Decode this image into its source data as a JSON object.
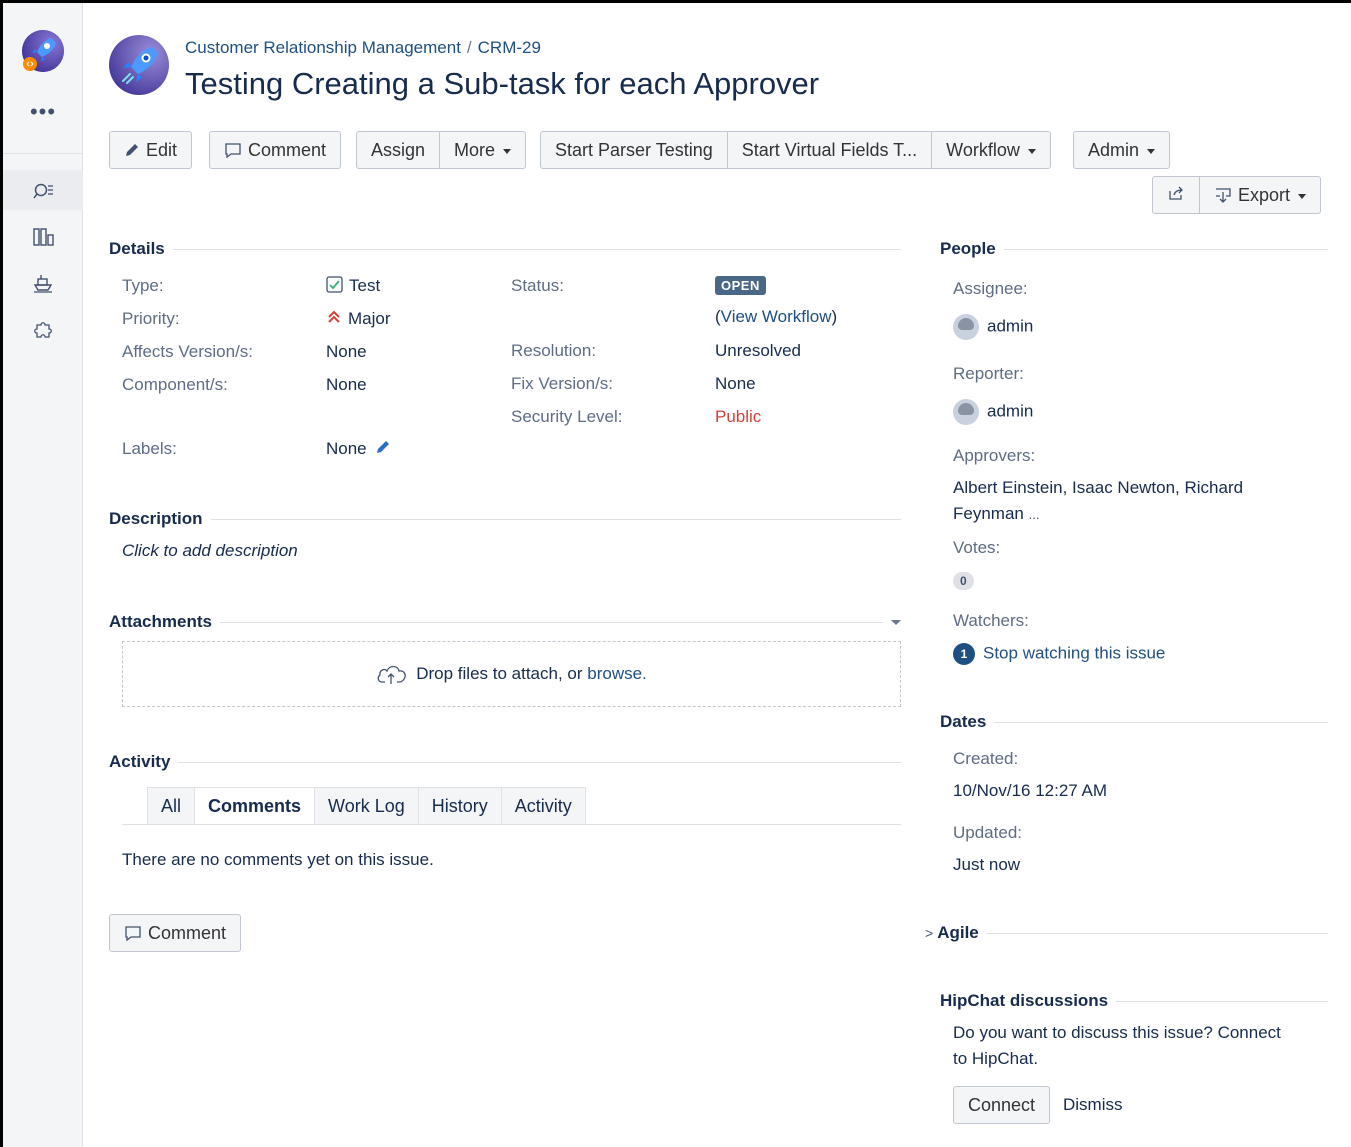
{
  "project": {
    "name": "Customer Relationship Management",
    "issue_key": "CRM-29"
  },
  "issue": {
    "title": "Testing Creating a Sub-task for each Approver"
  },
  "sidebar": {
    "more": "•••"
  },
  "toolbar": {
    "edit": "Edit",
    "comment": "Comment",
    "assign": "Assign",
    "more": "More",
    "start_parser": "Start Parser Testing",
    "start_virtual": "Start Virtual Fields T...",
    "workflow": "Workflow",
    "admin": "Admin",
    "export": "Export"
  },
  "details": {
    "heading": "Details",
    "type_label": "Type:",
    "type_value": "Test",
    "priority_label": "Priority:",
    "priority_value": "Major",
    "affects_label": "Affects Version/s:",
    "affects_value": "None",
    "component_label": "Component/s:",
    "component_value": "None",
    "labels_label": "Labels:",
    "labels_value": "None",
    "status_label": "Status:",
    "status_value": "OPEN",
    "view_workflow_open": "(",
    "view_workflow": "View Workflow",
    "view_workflow_close": ")",
    "resolution_label": "Resolution:",
    "resolution_value": "Unresolved",
    "fix_label": "Fix Version/s:",
    "fix_value": "None",
    "security_label": "Security Level:",
    "security_value": "Public"
  },
  "description": {
    "heading": "Description",
    "placeholder": "Click to add description"
  },
  "attachments": {
    "heading": "Attachments",
    "drop_text": "Drop files to attach, or ",
    "browse": "browse."
  },
  "activity": {
    "heading": "Activity",
    "tabs": [
      "All",
      "Comments",
      "Work Log",
      "History",
      "Activity"
    ],
    "empty": "There are no comments yet on this issue.",
    "comment_button": "Comment"
  },
  "people": {
    "heading": "People",
    "assignee_label": "Assignee:",
    "assignee": "admin",
    "reporter_label": "Reporter:",
    "reporter": "admin",
    "approvers_label": "Approvers:",
    "approvers_line1": "Albert Einstein, Isaac Newton, Richard",
    "approvers_line2": "Feynman",
    "approvers_more": "...",
    "votes_label": "Votes:",
    "votes": "0",
    "watchers_label": "Watchers:",
    "watchers_count": "1",
    "stop_watching": "Stop watching this issue"
  },
  "dates": {
    "heading": "Dates",
    "created_label": "Created:",
    "created": "10/Nov/16 12:27 AM",
    "updated_label": "Updated:",
    "updated": "Just now"
  },
  "agile": {
    "heading": "Agile"
  },
  "hipchat": {
    "heading": "HipChat discussions",
    "text_line1": "Do you want to discuss this issue? Connect",
    "text_line2": "to HipChat.",
    "connect": "Connect",
    "dismiss": "Dismiss"
  }
}
